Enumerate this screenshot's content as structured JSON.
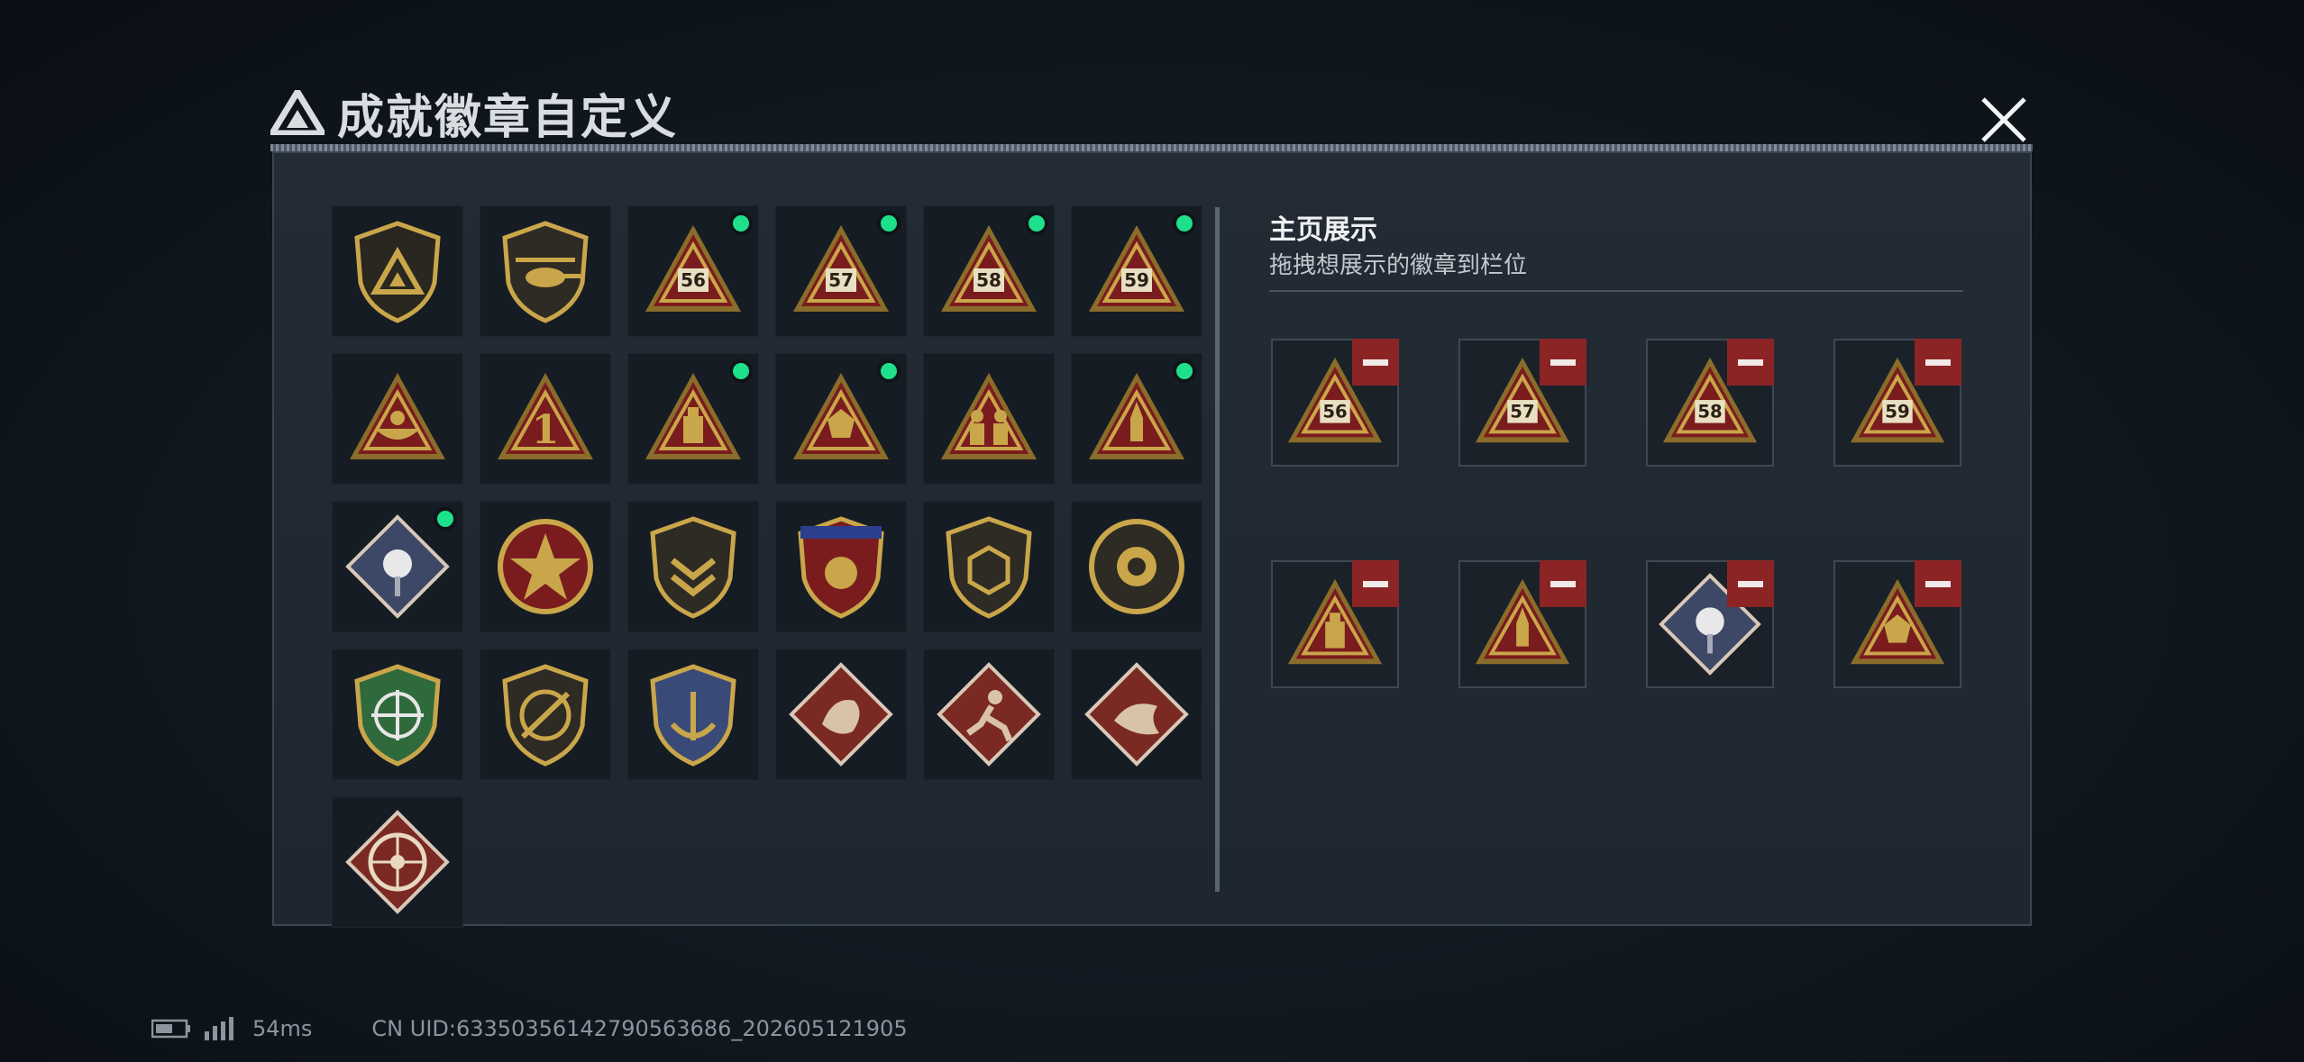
{
  "window": {
    "title": "成就徽章自定义",
    "close_icon": "close-icon"
  },
  "badges": [
    {
      "name": "badge-shield-logo",
      "selected": false
    },
    {
      "name": "badge-helicopter-shield",
      "selected": false
    },
    {
      "name": "badge-triangle-56",
      "label": "56",
      "selected": true
    },
    {
      "name": "badge-triangle-57",
      "label": "57",
      "selected": true
    },
    {
      "name": "badge-triangle-58",
      "label": "58",
      "selected": true
    },
    {
      "name": "badge-triangle-59",
      "label": "59",
      "selected": true
    },
    {
      "name": "badge-triangle-boat",
      "selected": false
    },
    {
      "name": "badge-triangle-1",
      "label": "1",
      "selected": false
    },
    {
      "name": "badge-triangle-usb",
      "selected": true
    },
    {
      "name": "badge-triangle-dice",
      "selected": true
    },
    {
      "name": "badge-triangle-soldiers",
      "selected": false
    },
    {
      "name": "badge-triangle-rocket",
      "selected": true
    },
    {
      "name": "badge-diamond-rose",
      "selected": true
    },
    {
      "name": "badge-star-wreath",
      "selected": false
    },
    {
      "name": "badge-shield-chevron",
      "selected": false
    },
    {
      "name": "badge-shield-stars-banner",
      "selected": false
    },
    {
      "name": "badge-shield-d20",
      "selected": false
    },
    {
      "name": "badge-circle-emblem",
      "selected": false
    },
    {
      "name": "badge-green-crosshair",
      "selected": false
    },
    {
      "name": "badge-crossed-gun",
      "selected": false
    },
    {
      "name": "badge-shield-anchor",
      "selected": false
    },
    {
      "name": "badge-diamond-dragon",
      "selected": false
    },
    {
      "name": "badge-diamond-runner",
      "selected": false
    },
    {
      "name": "badge-diamond-lizard",
      "selected": false
    },
    {
      "name": "badge-wheel-diamond",
      "selected": false
    }
  ],
  "display": {
    "title": "主页展示",
    "subtitle": "拖拽想展示的徽章到栏位",
    "slots": [
      {
        "badge": "badge-triangle-56",
        "label": "56"
      },
      {
        "badge": "badge-triangle-57",
        "label": "57"
      },
      {
        "badge": "badge-triangle-58",
        "label": "58"
      },
      {
        "badge": "badge-triangle-59",
        "label": "59"
      },
      {
        "badge": "badge-triangle-usb"
      },
      {
        "badge": "badge-triangle-rocket"
      },
      {
        "badge": "badge-diamond-rose"
      },
      {
        "badge": "badge-triangle-dice"
      }
    ]
  },
  "status": {
    "battery_icon": "battery-icon",
    "signal_icon": "signal-icon",
    "ping": "54ms",
    "uid": "CN UID:6335035614279056368​6_202605121905"
  },
  "colors": {
    "accent_green": "#1fe08a",
    "remove_red": "#8c2426",
    "gold": "#c9a64a",
    "badge_red": "#7a1c1e"
  }
}
